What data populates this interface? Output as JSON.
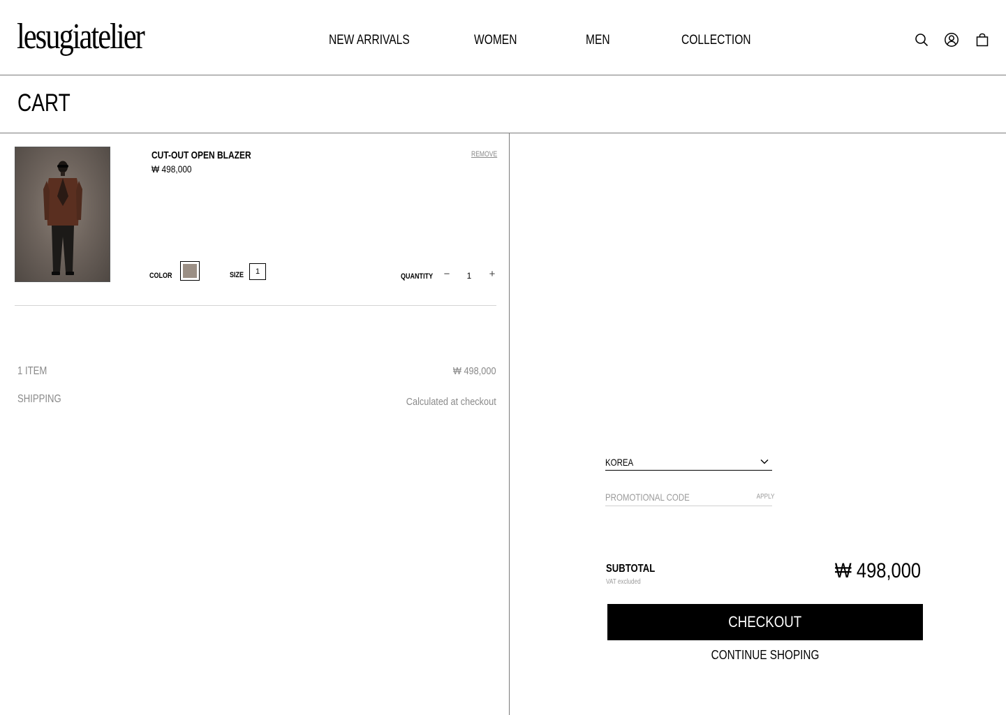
{
  "header": {
    "logo": "lesugiatelier",
    "nav": [
      "NEW ARRIVALS",
      "WOMEN",
      "MEN",
      "COLLECTION"
    ],
    "icons": [
      "search-icon",
      "account-icon",
      "shopping-bag-icon"
    ]
  },
  "page": {
    "title": "CART"
  },
  "cart": {
    "items": [
      {
        "name": "CUT-OUT OPEN BLAZER",
        "price": "₩ 498,000",
        "remove_label": "REMOVE",
        "color_label": "COLOR",
        "color_swatch": "#9b8f85",
        "size_label": "SIZE",
        "size_value": "1",
        "quantity_label": "QUANTITY",
        "quantity_minus": "−",
        "quantity_value": "1",
        "quantity_plus": "+"
      }
    ],
    "summary": {
      "items_label": "1 ITEM",
      "items_value": "₩ 498,000",
      "shipping_label": "SHIPPING",
      "shipping_value": "Calculated at checkout"
    }
  },
  "checkout_panel": {
    "country": "KOREA",
    "promo_placeholder": "PROMOTIONAL CODE",
    "promo_apply": "APPLY",
    "subtotal_label": "SUBTOTAL",
    "vat_note": "VAT excluded",
    "subtotal_value": "₩ 498,000",
    "checkout_label": "CHECKOUT",
    "continue_label": "CONTINUE SHOPING"
  }
}
